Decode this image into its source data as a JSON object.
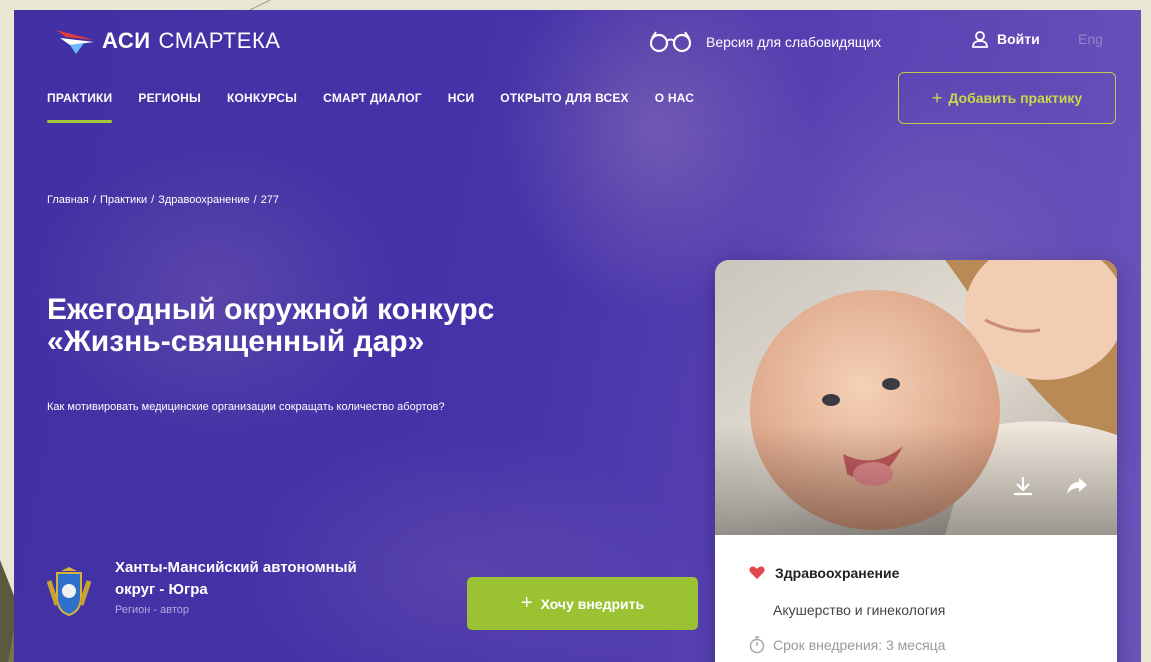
{
  "header": {
    "logo_bold": "АСИ",
    "logo_light": "СМАРТЕКА",
    "vision_label": "Версия для слабовидящих",
    "login_label": "Войти",
    "lang_label": "Eng"
  },
  "nav": {
    "items": [
      {
        "label": "ПРАКТИКИ",
        "active": true
      },
      {
        "label": "РЕГИОНЫ"
      },
      {
        "label": "КОНКУРСЫ"
      },
      {
        "label": "СМАРТ ДИАЛОГ"
      },
      {
        "label": "НСИ"
      },
      {
        "label": "ОТКРЫТО ДЛЯ ВСЕХ"
      },
      {
        "label": "О НАС"
      }
    ],
    "add_button": "Добавить практику"
  },
  "breadcrumb": [
    "Главная",
    "Практики",
    "Здравоохранение",
    "277"
  ],
  "main": {
    "title_line1": "Ежегодный окружной конкурс",
    "title_line2": "«Жизнь-священный дар»",
    "subtitle": "Как мотивировать медицинские организации сокращать количество абортов?"
  },
  "region": {
    "name_line1": "Ханты-Мансийский автономный",
    "name_line2": "округ - Югра",
    "role": "Регион - автор"
  },
  "implement_button": "Хочу внедрить",
  "card": {
    "category": "Здравоохранение",
    "subcategory": "Акушерство и гинекология",
    "term": "Срок внедрения: 3 месяца"
  },
  "colors": {
    "background": "#4633a9",
    "accent": "#9bc233",
    "outline_accent": "#b8cd43"
  },
  "icons": {
    "logo": "aci-logo-icon",
    "vision": "glasses-icon",
    "login": "user-icon",
    "download": "download-icon",
    "share": "share-icon",
    "category": "heart-icon",
    "term": "stopwatch-icon",
    "coat_of_arms": "coat-of-arms-icon"
  }
}
